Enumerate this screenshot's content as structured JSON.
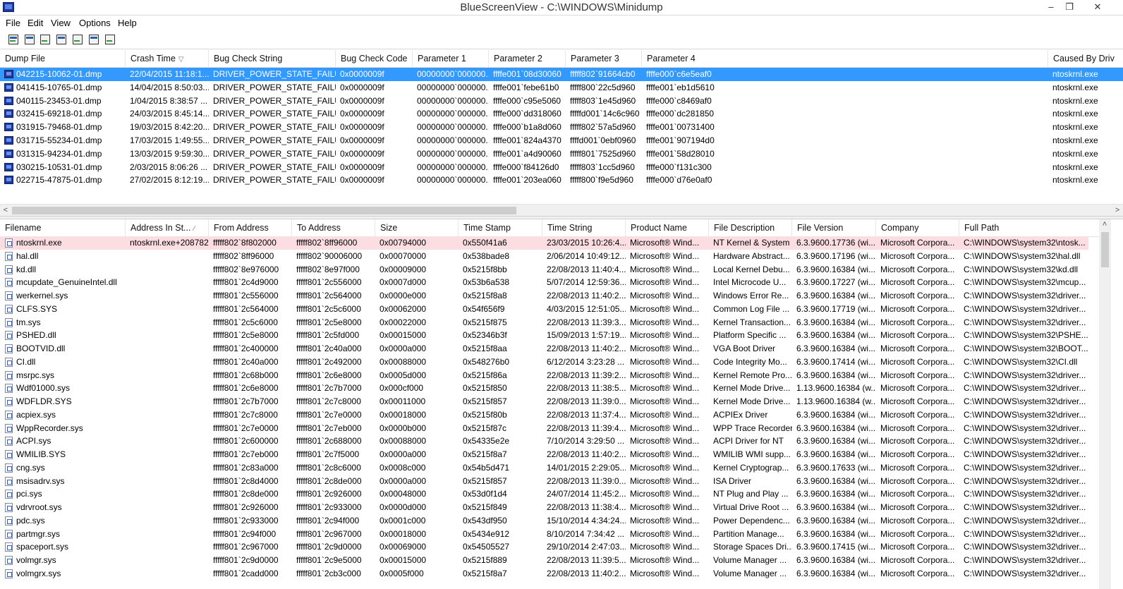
{
  "window": {
    "title": "BlueScreenView  -  C:\\WINDOWS\\Minidump",
    "minimize_glyph": "–",
    "restore_glyph": "❐",
    "close_glyph": "✕"
  },
  "menu": [
    "File",
    "Edit",
    "View",
    "Options",
    "Help"
  ],
  "toolbar_icons": [
    "html-report-icon",
    "save-icon",
    "refresh-icon",
    "copy-icon",
    "properties-icon",
    "find-icon",
    "exit-icon"
  ],
  "dumps": {
    "columns": [
      "Dump File",
      "Crash Time",
      "Bug Check String",
      "Bug Check Code",
      "Parameter 1",
      "Parameter 2",
      "Parameter 3",
      "Parameter 4",
      "Caused By Driv"
    ],
    "sort_glyph": "▽",
    "rows": [
      [
        "042215-10062-01.dmp",
        "22/04/2015 11:18:1...",
        "DRIVER_POWER_STATE_FAILURE",
        "0x0000009f",
        "00000000`000000...",
        "ffffe001`08d30060",
        "fffff802`91664cb0",
        "ffffe000`c6e5eaf0",
        "ntoskrnl.exe"
      ],
      [
        "041415-10765-01.dmp",
        "14/04/2015 8:50:03...",
        "DRIVER_POWER_STATE_FAILURE",
        "0x0000009f",
        "00000000`000000...",
        "ffffe001`febe61b0",
        "fffff800`22c5d960",
        "ffffe001`eb1d5610",
        "ntoskrnl.exe"
      ],
      [
        "040115-23453-01.dmp",
        "1/04/2015 8:38:57 ...",
        "DRIVER_POWER_STATE_FAILURE",
        "0x0000009f",
        "00000000`000000...",
        "ffffe000`c95e5060",
        "fffff803`1e45d960",
        "ffffe000`c8469af0",
        "ntoskrnl.exe"
      ],
      [
        "032415-69218-01.dmp",
        "24/03/2015 8:45:14...",
        "DRIVER_POWER_STATE_FAILURE",
        "0x0000009f",
        "00000000`000000...",
        "ffffe000`dd318060",
        "fffffd001`14c6c960",
        "ffffe000`dc281850",
        "ntoskrnl.exe"
      ],
      [
        "031915-79468-01.dmp",
        "19/03/2015 8:42:20...",
        "DRIVER_POWER_STATE_FAILURE",
        "0x0000009f",
        "00000000`000000...",
        "ffffe000`b1a8d060",
        "fffff802`57a5d960",
        "ffffe001`00731400",
        "ntoskrnl.exe"
      ],
      [
        "031715-55234-01.dmp",
        "17/03/2015 1:49:55...",
        "DRIVER_POWER_STATE_FAILURE",
        "0x0000009f",
        "00000000`000000...",
        "ffffe001`824a4370",
        "ffffd001`0ebf0960",
        "ffffe001`907194d0",
        "ntoskrnl.exe"
      ],
      [
        "031315-94234-01.dmp",
        "13/03/2015 9:59:30...",
        "DRIVER_POWER_STATE_FAILURE",
        "0x0000009f",
        "00000000`000000...",
        "ffffe001`a4d90060",
        "fffff801`7525d960",
        "ffffe001`58d28010",
        "ntoskrnl.exe"
      ],
      [
        "030215-10531-01.dmp",
        "2/03/2015 8:06:26 ...",
        "DRIVER_POWER_STATE_FAILURE",
        "0x0000009f",
        "00000000`000000...",
        "ffffe000`f84126d0",
        "fffff803`1cc5d960",
        "ffffe000`f131c300",
        "ntoskrnl.exe"
      ],
      [
        "022715-47875-01.dmp",
        "27/02/2015 8:12:19...",
        "DRIVER_POWER_STATE_FAILURE",
        "0x0000009f",
        "00000000`000000...",
        "ffffe001`203ea060",
        "fffff800`f9e5d960",
        "ffffe000`d76e0af0",
        "ntoskrnl.exe"
      ]
    ]
  },
  "modules": {
    "columns": [
      "Filename",
      "Address In St...",
      "From Address",
      "To Address",
      "Size",
      "Time Stamp",
      "Time String",
      "Product Name",
      "File Description",
      "File Version",
      "Company",
      "Full Path"
    ],
    "sort_glyph": "∕",
    "rows": [
      [
        "ntoskrnl.exe",
        "ntoskrnl.exe+208782",
        "fffff802`8f802000",
        "fffff802`8ff96000",
        "0x00794000",
        "0x550f41a6",
        "23/03/2015 10:26:4...",
        "Microsoft® Wind...",
        "NT Kernel & System",
        "6.3.9600.17736 (wi...",
        "Microsoft Corpora...",
        "C:\\WINDOWS\\system32\\ntosk..."
      ],
      [
        "hal.dll",
        "",
        "fffff802`8ff96000",
        "fffff802`90006000",
        "0x00070000",
        "0x538bade8",
        "2/06/2014 10:49:12...",
        "Microsoft® Wind...",
        "Hardware Abstract...",
        "6.3.9600.17196 (wi...",
        "Microsoft Corpora...",
        "C:\\WINDOWS\\system32\\hal.dll"
      ],
      [
        "kd.dll",
        "",
        "fffff802`8e976000",
        "fffff802`8e97f000",
        "0x00009000",
        "0x5215f8bb",
        "22/08/2013 11:40:4...",
        "Microsoft® Wind...",
        "Local Kernel Debu...",
        "6.3.9600.16384 (wi...",
        "Microsoft Corpora...",
        "C:\\WINDOWS\\system32\\kd.dll"
      ],
      [
        "mcupdate_GenuineIntel.dll",
        "",
        "fffff801`2c4d9000",
        "fffff801`2c556000",
        "0x0007d000",
        "0x53b6a538",
        "5/07/2014 12:59:36...",
        "Microsoft® Wind...",
        "Intel Microcode U...",
        "6.3.9600.17227 (wi...",
        "Microsoft Corpora...",
        "C:\\WINDOWS\\system32\\mcup..."
      ],
      [
        "werkernel.sys",
        "",
        "fffff801`2c556000",
        "fffff801`2c564000",
        "0x0000e000",
        "0x5215f8a8",
        "22/08/2013 11:40:2...",
        "Microsoft® Wind...",
        "Windows Error Re...",
        "6.3.9600.16384 (wi...",
        "Microsoft Corpora...",
        "C:\\WINDOWS\\system32\\driver..."
      ],
      [
        "CLFS.SYS",
        "",
        "fffff801`2c564000",
        "fffff801`2c5c6000",
        "0x00062000",
        "0x54f656f9",
        "4/03/2015 12:51:05...",
        "Microsoft® Wind...",
        "Common Log File ...",
        "6.3.9600.17719 (wi...",
        "Microsoft Corpora...",
        "C:\\WINDOWS\\system32\\driver..."
      ],
      [
        "tm.sys",
        "",
        "fffff801`2c5c6000",
        "fffff801`2c5e8000",
        "0x00022000",
        "0x5215f875",
        "22/08/2013 11:39:3...",
        "Microsoft® Wind...",
        "Kernel Transaction...",
        "6.3.9600.16384 (wi...",
        "Microsoft Corpora...",
        "C:\\WINDOWS\\system32\\driver..."
      ],
      [
        "PSHED.dll",
        "",
        "fffff801`2c5e8000",
        "fffff801`2c5fd000",
        "0x00015000",
        "0x52346b3f",
        "15/09/2013 1:57:19...",
        "Microsoft® Wind...",
        "Platform Specific ...",
        "6.3.9600.16384 (wi...",
        "Microsoft Corpora...",
        "C:\\WINDOWS\\system32\\PSHE..."
      ],
      [
        "BOOTVID.dll",
        "",
        "fffff801`2c400000",
        "fffff801`2c40a000",
        "0x0000a000",
        "0x5215f8aa",
        "22/08/2013 11:40:2...",
        "Microsoft® Wind...",
        "VGA Boot Driver",
        "6.3.9600.16384 (wi...",
        "Microsoft Corpora...",
        "C:\\WINDOWS\\system32\\BOOT..."
      ],
      [
        "CI.dll",
        "",
        "fffff801`2c40a000",
        "fffff801`2c492000",
        "0x00088000",
        "0x548276b0",
        "6/12/2014 3:23:28 ...",
        "Microsoft® Wind...",
        "Code Integrity Mo...",
        "6.3.9600.17414 (wi...",
        "Microsoft Corpora...",
        "C:\\WINDOWS\\system32\\CI.dll"
      ],
      [
        "msrpc.sys",
        "",
        "fffff801`2c68b000",
        "fffff801`2c6e8000",
        "0x0005d000",
        "0x5215f86a",
        "22/08/2013 11:39:2...",
        "Microsoft® Wind...",
        "Kernel Remote Pro...",
        "6.3.9600.16384 (wi...",
        "Microsoft Corpora...",
        "C:\\WINDOWS\\system32\\driver..."
      ],
      [
        "Wdf01000.sys",
        "",
        "fffff801`2c6e8000",
        "fffff801`2c7b7000",
        "0x000cf000",
        "0x5215f850",
        "22/08/2013 11:38:5...",
        "Microsoft® Wind...",
        "Kernel Mode Drive...",
        "1.13.9600.16384 (w...",
        "Microsoft Corpora...",
        "C:\\WINDOWS\\system32\\driver..."
      ],
      [
        "WDFLDR.SYS",
        "",
        "fffff801`2c7b7000",
        "fffff801`2c7c8000",
        "0x00011000",
        "0x5215f857",
        "22/08/2013 11:39:0...",
        "Microsoft® Wind...",
        "Kernel Mode Drive...",
        "1.13.9600.16384 (w...",
        "Microsoft Corpora...",
        "C:\\WINDOWS\\system32\\driver..."
      ],
      [
        "acpiex.sys",
        "",
        "fffff801`2c7c8000",
        "fffff801`2c7e0000",
        "0x00018000",
        "0x5215f80b",
        "22/08/2013 11:37:4...",
        "Microsoft® Wind...",
        "ACPIEx Driver",
        "6.3.9600.16384 (wi...",
        "Microsoft Corpora...",
        "C:\\WINDOWS\\system32\\driver..."
      ],
      [
        "WppRecorder.sys",
        "",
        "fffff801`2c7e0000",
        "fffff801`2c7eb000",
        "0x0000b000",
        "0x5215f87c",
        "22/08/2013 11:39:4...",
        "Microsoft® Wind...",
        "WPP Trace Recorder",
        "6.3.9600.16384 (wi...",
        "Microsoft Corpora...",
        "C:\\WINDOWS\\system32\\driver..."
      ],
      [
        "ACPI.sys",
        "",
        "fffff801`2c600000",
        "fffff801`2c688000",
        "0x00088000",
        "0x54335e2e",
        "7/10/2014 3:29:50 ...",
        "Microsoft® Wind...",
        "ACPI Driver for NT",
        "6.3.9600.16384 (wi...",
        "Microsoft Corpora...",
        "C:\\WINDOWS\\system32\\driver..."
      ],
      [
        "WMILIB.SYS",
        "",
        "fffff801`2c7eb000",
        "fffff801`2c7f5000",
        "0x0000a000",
        "0x5215f8a7",
        "22/08/2013 11:40:2...",
        "Microsoft® Wind...",
        "WMILIB WMI supp...",
        "6.3.9600.16384 (wi...",
        "Microsoft Corpora...",
        "C:\\WINDOWS\\system32\\driver..."
      ],
      [
        "cng.sys",
        "",
        "fffff801`2c83a000",
        "fffff801`2c8c6000",
        "0x0008c000",
        "0x54b5d471",
        "14/01/2015 2:29:05...",
        "Microsoft® Wind...",
        "Kernel Cryptograp...",
        "6.3.9600.17633 (wi...",
        "Microsoft Corpora...",
        "C:\\WINDOWS\\system32\\driver..."
      ],
      [
        "msisadrv.sys",
        "",
        "fffff801`2c8d4000",
        "fffff801`2c8de000",
        "0x0000a000",
        "0x5215f857",
        "22/08/2013 11:39:0...",
        "Microsoft® Wind...",
        "ISA Driver",
        "6.3.9600.16384 (wi...",
        "Microsoft Corpora...",
        "C:\\WINDOWS\\system32\\driver..."
      ],
      [
        "pci.sys",
        "",
        "fffff801`2c8de000",
        "fffff801`2c926000",
        "0x00048000",
        "0x53d0f1d4",
        "24/07/2014 11:45:2...",
        "Microsoft® Wind...",
        "NT Plug and Play ...",
        "6.3.9600.16384 (wi...",
        "Microsoft Corpora...",
        "C:\\WINDOWS\\system32\\driver..."
      ],
      [
        "vdrvroot.sys",
        "",
        "fffff801`2c926000",
        "fffff801`2c933000",
        "0x0000d000",
        "0x5215f849",
        "22/08/2013 11:38:4...",
        "Microsoft® Wind...",
        "Virtual Drive Root ...",
        "6.3.9600.16384 (wi...",
        "Microsoft Corpora...",
        "C:\\WINDOWS\\system32\\driver..."
      ],
      [
        "pdc.sys",
        "",
        "fffff801`2c933000",
        "fffff801`2c94f000",
        "0x0001c000",
        "0x543df950",
        "15/10/2014 4:34:24...",
        "Microsoft® Wind...",
        "Power Dependenc...",
        "6.3.9600.16384 (wi...",
        "Microsoft Corpora...",
        "C:\\WINDOWS\\system32\\driver..."
      ],
      [
        "partmgr.sys",
        "",
        "fffff801`2c94f000",
        "fffff801`2c967000",
        "0x00018000",
        "0x5434e912",
        "8/10/2014 7:34:42 ...",
        "Microsoft® Wind...",
        "Partition Manage...",
        "6.3.9600.16384 (wi...",
        "Microsoft Corpora...",
        "C:\\WINDOWS\\system32\\driver..."
      ],
      [
        "spaceport.sys",
        "",
        "fffff801`2c967000",
        "fffff801`2c9d0000",
        "0x00069000",
        "0x54505527",
        "29/10/2014 2:47:03...",
        "Microsoft® Wind...",
        "Storage Spaces Dri...",
        "6.3.9600.17415 (wi...",
        "Microsoft Corpora...",
        "C:\\WINDOWS\\system32\\driver..."
      ],
      [
        "volmgr.sys",
        "",
        "fffff801`2c9d0000",
        "fffff801`2c9e5000",
        "0x00015000",
        "0x5215f889",
        "22/08/2013 11:39:5...",
        "Microsoft® Wind...",
        "Volume Manager ...",
        "6.3.9600.16384 (wi...",
        "Microsoft Corpora...",
        "C:\\WINDOWS\\system32\\driver..."
      ],
      [
        "volmgrx.sys",
        "",
        "fffff801`2cadd000",
        "fffff801`2cb3c000",
        "0x0005f000",
        "0x5215f8a7",
        "22/08/2013 11:40:2...",
        "Microsoft® Wind...",
        "Volume Manager ...",
        "6.3.9600.16384 (wi...",
        "Microsoft Corpora...",
        "C:\\WINDOWS\\system32\\driver..."
      ]
    ]
  },
  "scroll": {
    "left_glyph": "<",
    "right_glyph": ">",
    "up_glyph": "˄"
  }
}
